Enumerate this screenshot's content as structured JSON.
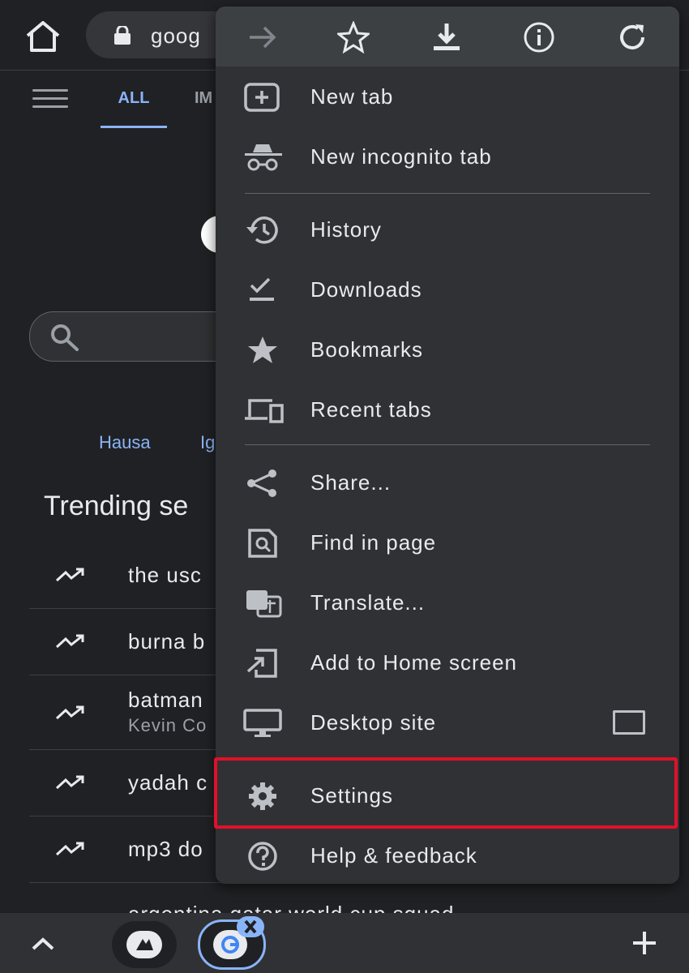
{
  "address_bar": {
    "url": "goog"
  },
  "page": {
    "tabs": [
      {
        "label": "ALL"
      },
      {
        "label": "IM"
      }
    ],
    "languages": [
      "Hausa",
      "Ig"
    ],
    "trending_title": "Trending se",
    "trending": [
      {
        "text": "the usc"
      },
      {
        "text": "burna b"
      },
      {
        "text": "batman",
        "sub": "Kevin Co"
      },
      {
        "text": "yadah c"
      },
      {
        "text": "mp3 do"
      }
    ],
    "trending_last": "argentina qatar world cup squad"
  },
  "menu": {
    "toolbar": [
      "forward-icon",
      "bookmark-star-icon",
      "download-icon",
      "info-icon",
      "refresh-icon"
    ],
    "items": [
      {
        "label": "New tab",
        "icon": "new-tab-icon"
      },
      {
        "label": "New incognito tab",
        "icon": "incognito-icon"
      },
      {
        "label": "History",
        "icon": "history-icon"
      },
      {
        "label": "Downloads",
        "icon": "downloads-icon"
      },
      {
        "label": "Bookmarks",
        "icon": "star-icon"
      },
      {
        "label": "Recent tabs",
        "icon": "devices-icon"
      },
      {
        "label": "Share...",
        "icon": "share-icon"
      },
      {
        "label": "Find in page",
        "icon": "find-in-page-icon"
      },
      {
        "label": "Translate...",
        "icon": "translate-icon"
      },
      {
        "label": "Add to Home screen",
        "icon": "add-to-home-icon"
      },
      {
        "label": "Desktop site",
        "icon": "desktop-icon",
        "checked": false
      },
      {
        "label": "Settings",
        "icon": "gear-icon",
        "highlighted": true
      },
      {
        "label": "Help & feedback",
        "icon": "help-icon"
      }
    ]
  },
  "colors": {
    "accent": "#8ab4f8",
    "highlight": "#e0102a",
    "menu_bg": "#303134"
  }
}
